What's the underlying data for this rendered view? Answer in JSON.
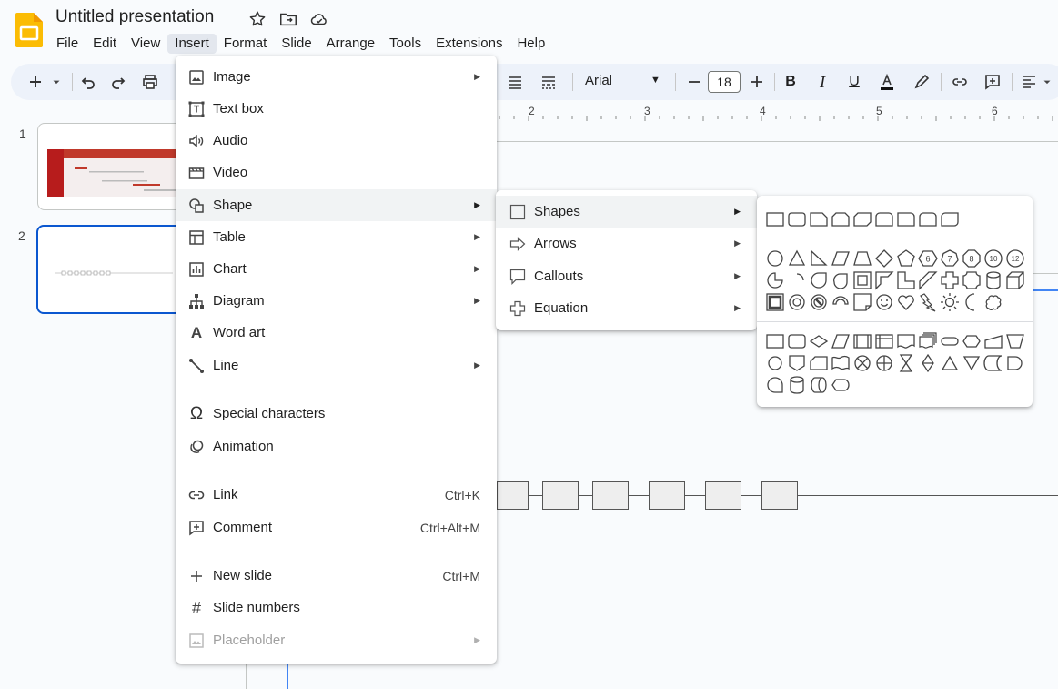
{
  "app": {
    "title": "Untitled presentation",
    "brand_color": "#fbbc04"
  },
  "menubar": [
    "File",
    "Edit",
    "View",
    "Insert",
    "Format",
    "Slide",
    "Arrange",
    "Tools",
    "Extensions",
    "Help"
  ],
  "active_menu": "Insert",
  "toolbar": {
    "font_name": "Arial",
    "font_size": "18"
  },
  "slides": {
    "numbers": [
      "1",
      "2"
    ]
  },
  "ruler": {
    "labels": [
      "2",
      "3",
      "4",
      "5",
      "6"
    ]
  },
  "insert_menu": {
    "items": [
      {
        "label": "Image",
        "icon": "image-icon",
        "submenu": true
      },
      {
        "label": "Text box",
        "icon": "text-box-icon"
      },
      {
        "label": "Audio",
        "icon": "audio-icon"
      },
      {
        "label": "Video",
        "icon": "video-icon"
      },
      {
        "label": "Shape",
        "icon": "shape-icon",
        "submenu": true,
        "highlighted": true
      },
      {
        "label": "Table",
        "icon": "table-icon",
        "submenu": true
      },
      {
        "label": "Chart",
        "icon": "chart-icon",
        "submenu": true
      },
      {
        "label": "Diagram",
        "icon": "diagram-icon",
        "submenu": true
      },
      {
        "label": "Word art",
        "icon": "word-art-icon"
      },
      {
        "label": "Line",
        "icon": "line-icon",
        "submenu": true
      },
      {
        "label": "Special characters",
        "icon": "omega-icon"
      },
      {
        "label": "Animation",
        "icon": "animation-icon"
      },
      {
        "label": "Link",
        "icon": "link-icon",
        "shortcut": "Ctrl+K"
      },
      {
        "label": "Comment",
        "icon": "comment-icon",
        "shortcut": "Ctrl+Alt+M"
      },
      {
        "label": "New slide",
        "icon": "plus-icon",
        "shortcut": "Ctrl+M"
      },
      {
        "label": "Slide numbers",
        "icon": "hash-icon"
      },
      {
        "label": "Placeholder",
        "icon": "placeholder-icon",
        "submenu": true,
        "disabled": true
      }
    ]
  },
  "shape_menu": {
    "items": [
      {
        "label": "Shapes",
        "icon": "square-icon",
        "highlighted": true
      },
      {
        "label": "Arrows",
        "icon": "arrow-icon"
      },
      {
        "label": "Callouts",
        "icon": "callout-icon"
      },
      {
        "label": "Equation",
        "icon": "equation-plus-icon"
      }
    ]
  }
}
